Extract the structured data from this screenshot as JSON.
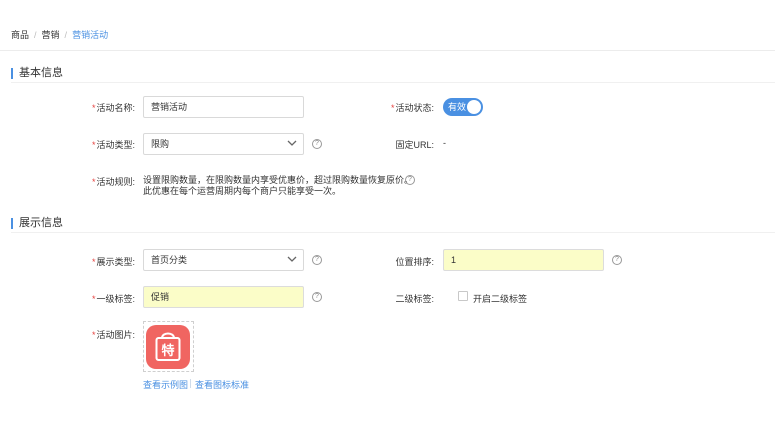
{
  "breadcrumb": {
    "items": [
      "商品",
      "营销"
    ],
    "current": "营销活动"
  },
  "sections": {
    "basic": "基本信息",
    "display": "展示信息"
  },
  "basic": {
    "name_label": "活动名称:",
    "name_value": "营销活动",
    "status_label": "活动状态:",
    "status_value": "有效",
    "status_on": true,
    "type_label": "活动类型:",
    "type_value": "限购",
    "url_label": "固定URL:",
    "url_value": "-",
    "rule_label": "活动规则:",
    "rule_line1": "设置限购数量，在限购数量内享受优惠价，超过限购数量恢复原价。",
    "rule_line2": "此优惠在每个运营周期内每个商户只能享受一次。"
  },
  "display": {
    "display_type_label": "展示类型:",
    "display_type_value": "首页分类",
    "sort_label": "位置排序:",
    "sort_value": "1",
    "level1_label": "一级标签:",
    "level1_value": "促销",
    "level2_label": "二级标签:",
    "level2_checkbox_label": "开启二级标签",
    "level2_checked": false,
    "image_label": "活动图片:",
    "image_char": "特",
    "link_example": "查看示例图",
    "link_standard": "查看图标标准"
  },
  "icons": {
    "help": "question-circle-icon",
    "chevron": "chevron-down-icon",
    "badge": "shopping-bag-icon"
  },
  "colors": {
    "accent": "#4a90e2",
    "required": "#e64340",
    "highlight": "#fbfdc8",
    "badge": "#f06561"
  }
}
